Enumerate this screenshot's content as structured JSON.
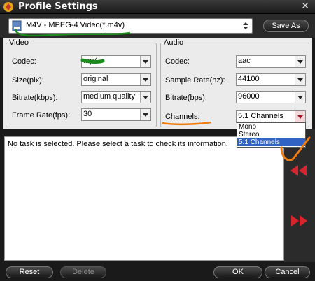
{
  "window": {
    "title": "Profile Settings",
    "close_symbol": "✕"
  },
  "toolbar": {
    "profile_value": "M4V - MPEG-4 Video(*.m4v)",
    "save_as_label": "Save As"
  },
  "video": {
    "legend": "Video",
    "codec_label": "Codec:",
    "codec_value": "mp4",
    "size_label": "Size(pix):",
    "size_value": "original",
    "bitrate_label": "Bitrate(kbps):",
    "bitrate_value": "medium quality",
    "framerate_label": "Frame Rate(fps):",
    "framerate_value": "30"
  },
  "audio": {
    "legend": "Audio",
    "codec_label": "Codec:",
    "codec_value": "aac",
    "samplerate_label": "Sample Rate(hz):",
    "samplerate_value": "44100",
    "bitrate_label": "Bitrate(bps):",
    "bitrate_value": "96000",
    "channels_label": "Channels:",
    "channels_value": "5.1 Channels",
    "channels_options": [
      "Mono",
      "Stereo",
      "5.1 Channels"
    ]
  },
  "info": {
    "text": "No task is selected. Please select a task to check its information."
  },
  "buttons": {
    "reset": "Reset",
    "delete": "Delete",
    "ok": "OK",
    "cancel": "Cancel"
  },
  "colors": {
    "accent_nav": "#d8242c",
    "annotation_green": "#1c8a1c",
    "annotation_orange": "#f07d12",
    "selection": "#3163c5"
  }
}
